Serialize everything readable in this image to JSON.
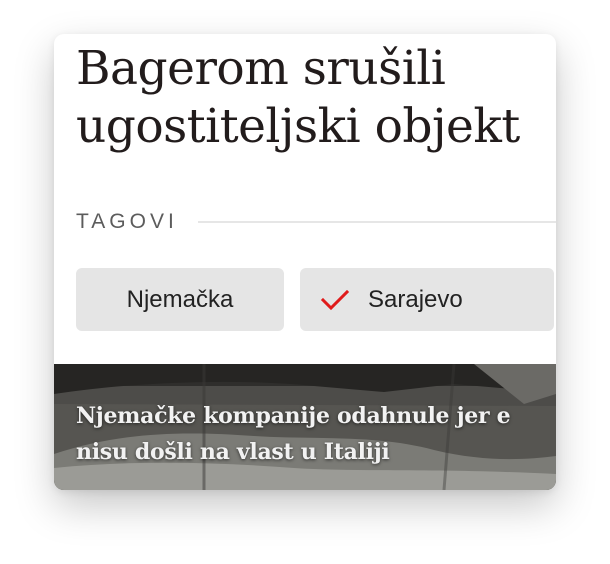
{
  "article": {
    "headline_line1": "Bagerom srušili",
    "headline_line2": "ugostiteljski objekt"
  },
  "tags": {
    "label": "TAGOVI",
    "items": [
      {
        "label": "Njemačka",
        "checked": false
      },
      {
        "label": "Sarajevo",
        "checked": true,
        "check_icon": "checkmark-icon",
        "check_color": "#e01b1b"
      }
    ]
  },
  "teaser": {
    "title_line1": "Njemačke kompanije odahnule jer e",
    "title_line2": "nisu došli na vlast u Italiji"
  },
  "colors": {
    "tag_background": "#e5e5e5",
    "accent": "#e01b1b"
  }
}
